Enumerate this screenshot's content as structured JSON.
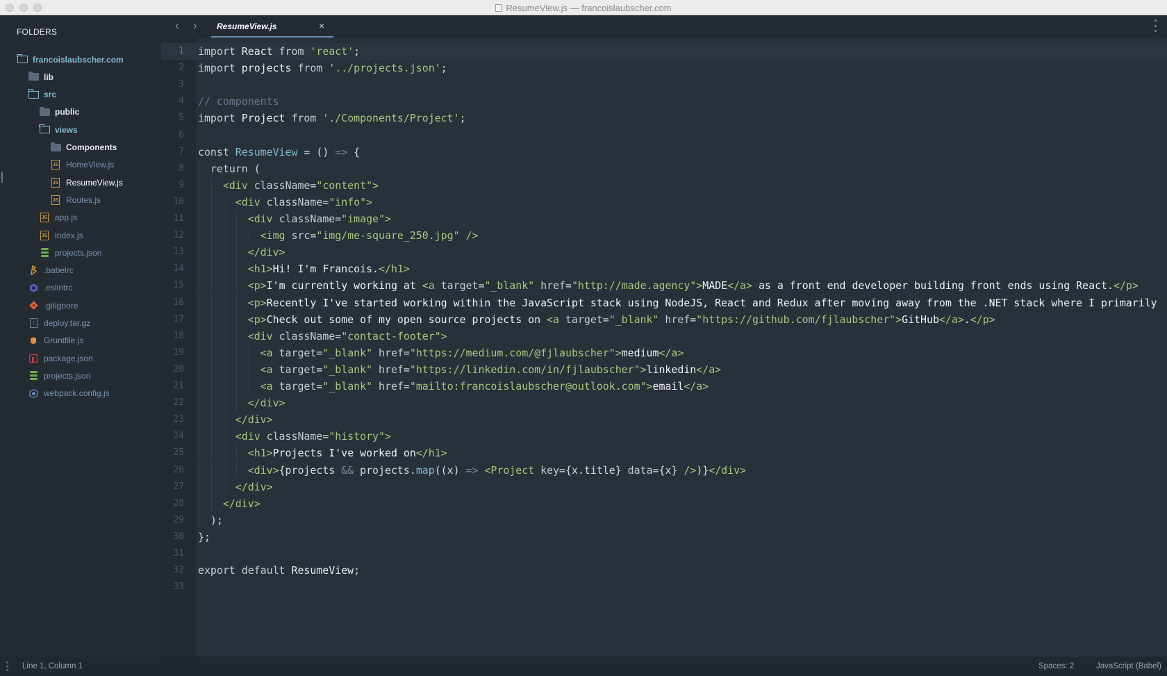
{
  "window": {
    "title": "ResumeView.js — francoislaubscher.com"
  },
  "sidebar": {
    "heading": "FOLDERS",
    "items": [
      {
        "label": "francoislaubscher.com",
        "kind": "root-folder",
        "depth": 0
      },
      {
        "label": "lib",
        "kind": "folder",
        "depth": 1
      },
      {
        "label": "src",
        "kind": "open-folder",
        "depth": 1
      },
      {
        "label": "public",
        "kind": "folder",
        "depth": 2
      },
      {
        "label": "views",
        "kind": "open-folder",
        "depth": 2
      },
      {
        "label": "Components",
        "kind": "folder",
        "depth": 3
      },
      {
        "label": "HomeView.js",
        "kind": "js",
        "depth": 3
      },
      {
        "label": "ResumeView.js",
        "kind": "js-active",
        "depth": 3
      },
      {
        "label": "Routes.js",
        "kind": "js",
        "depth": 3
      },
      {
        "label": "app.js",
        "kind": "js",
        "depth": 2
      },
      {
        "label": "index.js",
        "kind": "js",
        "depth": 2
      },
      {
        "label": "projects.json",
        "kind": "json",
        "depth": 2
      },
      {
        "label": ".babelrc",
        "kind": "babel",
        "depth": 1
      },
      {
        "label": ".eslintrc",
        "kind": "eslint",
        "depth": 1
      },
      {
        "label": ".gitignore",
        "kind": "git",
        "depth": 1
      },
      {
        "label": "deploy.tar.gz",
        "kind": "archive",
        "depth": 1
      },
      {
        "label": "Gruntfile.js",
        "kind": "grunt",
        "depth": 1
      },
      {
        "label": "package.json",
        "kind": "npm",
        "depth": 1
      },
      {
        "label": "projects.json",
        "kind": "json",
        "depth": 1
      },
      {
        "label": "webpack.config.js",
        "kind": "webpack",
        "depth": 1
      }
    ]
  },
  "tabs": {
    "back_icon": "‹",
    "forward_icon": "›",
    "active_tab": "ResumeView.js",
    "close_icon": "×"
  },
  "editor": {
    "current_line": 1,
    "lines": [
      [
        [
          "kw",
          "import "
        ],
        [
          "id",
          "React "
        ],
        [
          "kw",
          "from "
        ],
        [
          "str",
          "'react'"
        ],
        [
          "p",
          ";"
        ]
      ],
      [
        [
          "kw",
          "import "
        ],
        [
          "id",
          "projects "
        ],
        [
          "kw",
          "from "
        ],
        [
          "str",
          "'../projects.json'"
        ],
        [
          "p",
          ";"
        ]
      ],
      [],
      [
        [
          "cm",
          "// components"
        ]
      ],
      [
        [
          "kw",
          "import "
        ],
        [
          "id",
          "Project "
        ],
        [
          "kw",
          "from "
        ],
        [
          "str",
          "'./Components/Project'"
        ],
        [
          "p",
          ";"
        ]
      ],
      [],
      [
        [
          "kw",
          "const "
        ],
        [
          "fn",
          "ResumeView"
        ],
        [
          "p",
          " = () "
        ],
        [
          "op",
          "=>"
        ],
        [
          "p",
          " {"
        ]
      ],
      [
        [
          "p",
          "  "
        ],
        [
          "kw",
          "return "
        ],
        [
          "p",
          "("
        ]
      ],
      [
        [
          "p",
          "    "
        ],
        [
          "tag",
          "<div "
        ],
        [
          "attr",
          "className"
        ],
        [
          "p",
          "="
        ],
        [
          "str",
          "\"content\""
        ],
        [
          "tag",
          ">"
        ]
      ],
      [
        [
          "p",
          "      "
        ],
        [
          "tag",
          "<div "
        ],
        [
          "attr",
          "className"
        ],
        [
          "p",
          "="
        ],
        [
          "str",
          "\"info\""
        ],
        [
          "tag",
          ">"
        ]
      ],
      [
        [
          "p",
          "        "
        ],
        [
          "tag",
          "<div "
        ],
        [
          "attr",
          "className"
        ],
        [
          "p",
          "="
        ],
        [
          "str",
          "\"image\""
        ],
        [
          "tag",
          ">"
        ]
      ],
      [
        [
          "p",
          "          "
        ],
        [
          "tag",
          "<img "
        ],
        [
          "attr",
          "src"
        ],
        [
          "p",
          "="
        ],
        [
          "str",
          "\"img/me-square_250.jpg\""
        ],
        [
          "tag",
          " />"
        ]
      ],
      [
        [
          "p",
          "        "
        ],
        [
          "tag",
          "</div>"
        ]
      ],
      [
        [
          "p",
          "        "
        ],
        [
          "tag",
          "<h1>"
        ],
        [
          "txt",
          "Hi! I'm Francois."
        ],
        [
          "tag",
          "</h1>"
        ]
      ],
      [
        [
          "p",
          "        "
        ],
        [
          "tag",
          "<p>"
        ],
        [
          "txt",
          "I'm currently working at "
        ],
        [
          "tag",
          "<a "
        ],
        [
          "attr",
          "target"
        ],
        [
          "p",
          "="
        ],
        [
          "str",
          "\"_blank\""
        ],
        [
          "attr",
          " href"
        ],
        [
          "p",
          "="
        ],
        [
          "str",
          "\"http://made.agency\""
        ],
        [
          "tag",
          ">"
        ],
        [
          "txt",
          "MADE"
        ],
        [
          "tag",
          "</a>"
        ],
        [
          "txt",
          " as a front end developer building front ends using React."
        ],
        [
          "tag",
          "</p>"
        ]
      ],
      [
        [
          "p",
          "        "
        ],
        [
          "tag",
          "<p>"
        ],
        [
          "txt",
          "Recently I've started working within the JavaScript stack using NodeJS, React and Redux after moving away from the .NET stack where I primarily"
        ]
      ],
      [
        [
          "p",
          "        "
        ],
        [
          "tag",
          "<p>"
        ],
        [
          "txt",
          "Check out some of my open source projects on "
        ],
        [
          "tag",
          "<a "
        ],
        [
          "attr",
          "target"
        ],
        [
          "p",
          "="
        ],
        [
          "str",
          "\"_blank\""
        ],
        [
          "attr",
          " href"
        ],
        [
          "p",
          "="
        ],
        [
          "str",
          "\"https://github.com/fjlaubscher\""
        ],
        [
          "tag",
          ">"
        ],
        [
          "txt",
          "GitHub"
        ],
        [
          "tag",
          "</a>"
        ],
        [
          "txt",
          "."
        ],
        [
          "tag",
          "</p>"
        ]
      ],
      [
        [
          "p",
          "        "
        ],
        [
          "tag",
          "<div "
        ],
        [
          "attr",
          "className"
        ],
        [
          "p",
          "="
        ],
        [
          "str",
          "\"contact-footer\""
        ],
        [
          "tag",
          ">"
        ]
      ],
      [
        [
          "p",
          "          "
        ],
        [
          "tag",
          "<a "
        ],
        [
          "attr",
          "target"
        ],
        [
          "p",
          "="
        ],
        [
          "str",
          "\"_blank\""
        ],
        [
          "attr",
          " href"
        ],
        [
          "p",
          "="
        ],
        [
          "str",
          "\"https://medium.com/@fjlaubscher\""
        ],
        [
          "tag",
          ">"
        ],
        [
          "txt",
          "medium"
        ],
        [
          "tag",
          "</a>"
        ]
      ],
      [
        [
          "p",
          "          "
        ],
        [
          "tag",
          "<a "
        ],
        [
          "attr",
          "target"
        ],
        [
          "p",
          "="
        ],
        [
          "str",
          "\"_blank\""
        ],
        [
          "attr",
          " href"
        ],
        [
          "p",
          "="
        ],
        [
          "str",
          "\"https://linkedin.com/in/fjlaubscher\""
        ],
        [
          "tag",
          ">"
        ],
        [
          "txt",
          "linkedin"
        ],
        [
          "tag",
          "</a>"
        ]
      ],
      [
        [
          "p",
          "          "
        ],
        [
          "tag",
          "<a "
        ],
        [
          "attr",
          "target"
        ],
        [
          "p",
          "="
        ],
        [
          "str",
          "\"_blank\""
        ],
        [
          "attr",
          " href"
        ],
        [
          "p",
          "="
        ],
        [
          "str",
          "\"mailto:francoislaubscher@outlook.com\""
        ],
        [
          "tag",
          ">"
        ],
        [
          "txt",
          "email"
        ],
        [
          "tag",
          "</a>"
        ]
      ],
      [
        [
          "p",
          "        "
        ],
        [
          "tag",
          "</div>"
        ]
      ],
      [
        [
          "p",
          "      "
        ],
        [
          "tag",
          "</div>"
        ]
      ],
      [
        [
          "p",
          "      "
        ],
        [
          "tag",
          "<div "
        ],
        [
          "attr",
          "className"
        ],
        [
          "p",
          "="
        ],
        [
          "str",
          "\"history\""
        ],
        [
          "tag",
          ">"
        ]
      ],
      [
        [
          "p",
          "        "
        ],
        [
          "tag",
          "<h1>"
        ],
        [
          "txt",
          "Projects I've worked on"
        ],
        [
          "tag",
          "</h1>"
        ]
      ],
      [
        [
          "p",
          "        "
        ],
        [
          "tag",
          "<div>"
        ],
        [
          "p",
          "{projects "
        ],
        [
          "op",
          "&&"
        ],
        [
          "p",
          " projects."
        ],
        [
          "fn",
          "map"
        ],
        [
          "p",
          "((x) "
        ],
        [
          "op",
          "=>"
        ],
        [
          "p",
          " "
        ],
        [
          "tag",
          "<Project "
        ],
        [
          "attr",
          "key"
        ],
        [
          "p",
          "={x.title} "
        ],
        [
          "attr",
          "data"
        ],
        [
          "p",
          "={x} "
        ],
        [
          "tag",
          "/>"
        ],
        [
          "p",
          ")}"
        ],
        [
          "tag",
          "</div>"
        ]
      ],
      [
        [
          "p",
          "      "
        ],
        [
          "tag",
          "</div>"
        ]
      ],
      [
        [
          "p",
          "    "
        ],
        [
          "tag",
          "</div>"
        ]
      ],
      [
        [
          "p",
          "  );"
        ]
      ],
      [
        [
          "p",
          "};"
        ]
      ],
      [],
      [
        [
          "kw",
          "export default "
        ],
        [
          "id",
          "ResumeView"
        ],
        [
          "p",
          ";"
        ]
      ],
      []
    ]
  },
  "status": {
    "position": "Line 1, Column 1",
    "spaces": "Spaces: 2",
    "syntax": "JavaScript (Babel)"
  },
  "colors": {
    "kw": "#c8ccd2",
    "id": "#e8eaee",
    "str": "#a8c77f",
    "cm": "#6b7787",
    "fn": "#7fbcd0",
    "op": "#7f8b99",
    "tag": "#a8c77f",
    "attr": "#c8ccd2",
    "txt": "#eef0f3",
    "p": "#d7dae0"
  }
}
